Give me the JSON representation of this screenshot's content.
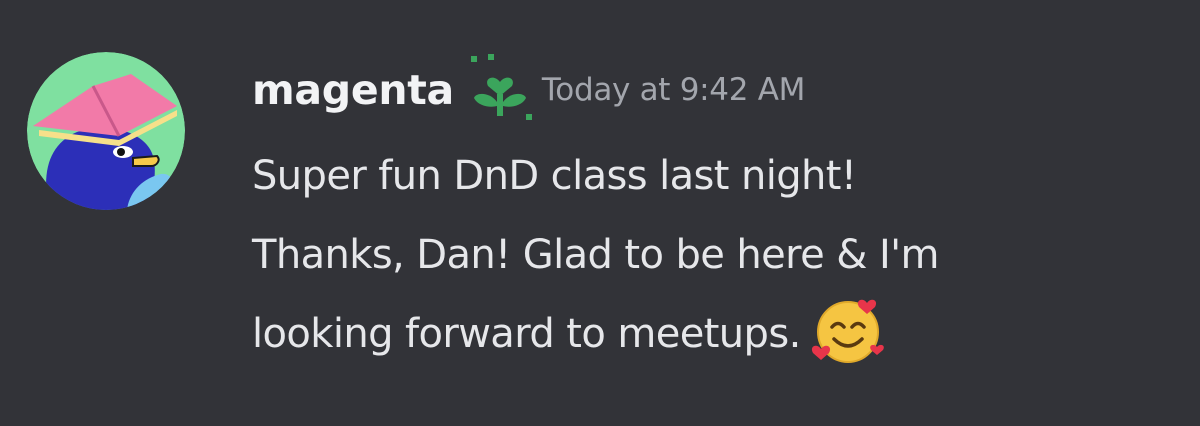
{
  "message": {
    "author": {
      "username": "magenta",
      "avatar_icon": "penguin-with-book-avatar",
      "role_icon": "green-sprout-icon"
    },
    "timestamp": "Today at 9:42 AM",
    "content_lines": [
      "Super fun DnD class last night!",
      "Thanks, Dan! Glad to be here & I'm",
      "looking forward to meetups."
    ],
    "emoji": "smiling-face-with-hearts-icon"
  },
  "colors": {
    "background": "#323338",
    "username": "#f2f3f5",
    "timestamp": "#a3a6ad",
    "text": "#e6e7ea",
    "role_icon": "#3ba55c"
  }
}
